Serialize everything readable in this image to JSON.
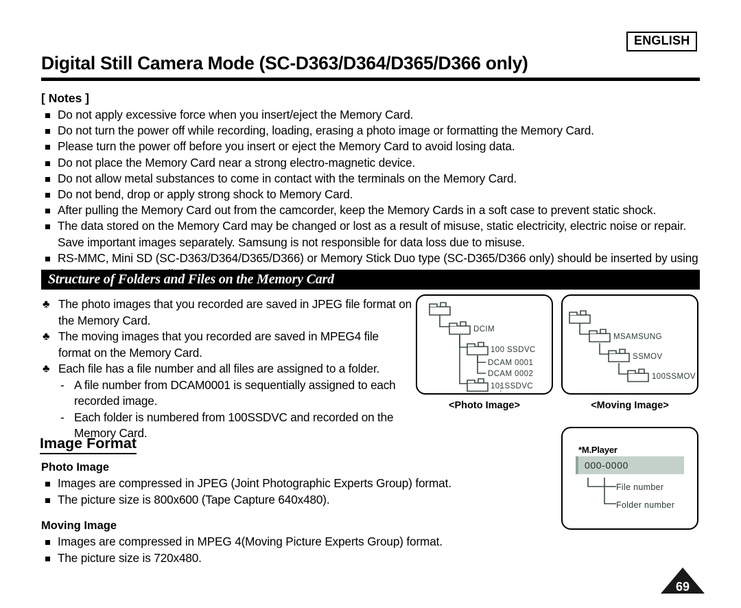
{
  "header": {
    "language_badge": "ENGLISH",
    "title": "Digital Still Camera Mode (SC-D363/D364/D365/D366 only)"
  },
  "notes": {
    "heading": "[ Notes ]",
    "items": [
      "Do not apply excessive force when you insert/eject the Memory Card.",
      "Do not turn the power off while recording, loading, erasing a photo image or formatting the Memory Card.",
      "Please turn the power off before you insert or eject the Memory Card to avoid losing data.",
      "Do not place the Memory Card near a strong electro-magnetic device.",
      "Do not allow metal substances to come in contact with the terminals on the Memory Card.",
      "Do not bend, drop or apply strong shock to Memory Card.",
      "After pulling the Memory Card out from the camcorder, keep the Memory Cards in a soft case to prevent static shock.",
      "The data stored on the Memory Card may be changed or lost as a result of misuse, static electricity, electric noise or repair. Save important images separately. Samsung is not responsible for data loss due to misuse.",
      "RS-MMC, Mini SD (SC-D363/D364/D365/D366) or Memory Stick Duo type (SC-D365/D366 only) should be inserted by using the Adaptor (not supplied)."
    ]
  },
  "structure_section": {
    "bar_title": "Structure of Folders and Files on the Memory Card",
    "bullets": [
      "The photo images that you recorded are saved in JPEG file format on the Memory Card.",
      "The moving images that you recorded are saved in MPEG4 file format on the Memory Card.",
      "Each file has a file number and all files are assigned to a folder."
    ],
    "sub_bullets": [
      "A file number from DCAM0001 is sequentially assigned to each recorded image.",
      "Each folder is numbered from 100SSDVC and recorded on the Memory Card."
    ],
    "bullet_glyph": "♣",
    "dash_glyph": "-"
  },
  "photo_tree": {
    "caption": "<Photo Image>",
    "labels": {
      "dcim": "DCIM",
      "folder_100": "100 SSDVC",
      "file_1": "DCAM 0001",
      "file_2": "DCAM 0002",
      "ellipsis": "⋮",
      "folder_101": "101SSDVC"
    }
  },
  "moving_tree": {
    "caption": "<Moving Image>",
    "labels": {
      "msamsung": "MSAMSUNG",
      "ssmov": "SSMOV",
      "folder_100": "100SSMOV"
    }
  },
  "image_format": {
    "heading": "Image Format",
    "photo": {
      "sub_heading": "Photo Image",
      "items": [
        "Images are compressed in JPEG (Joint Photographic Experts Group) format.",
        "The picture size is 800x600 (Tape Capture 640x480)."
      ]
    },
    "moving": {
      "sub_heading": "Moving Image",
      "items": [
        "Images are compressed in MPEG 4(Moving Picture Experts Group) format.",
        "The picture size is 720x480."
      ]
    }
  },
  "mplayer_diagram": {
    "title": "*M.Player",
    "display_value": "000-0000",
    "file_number_label": "File number",
    "folder_number_label": "Folder number",
    "bar_color": "#c4d1c9"
  },
  "page_number": "69"
}
